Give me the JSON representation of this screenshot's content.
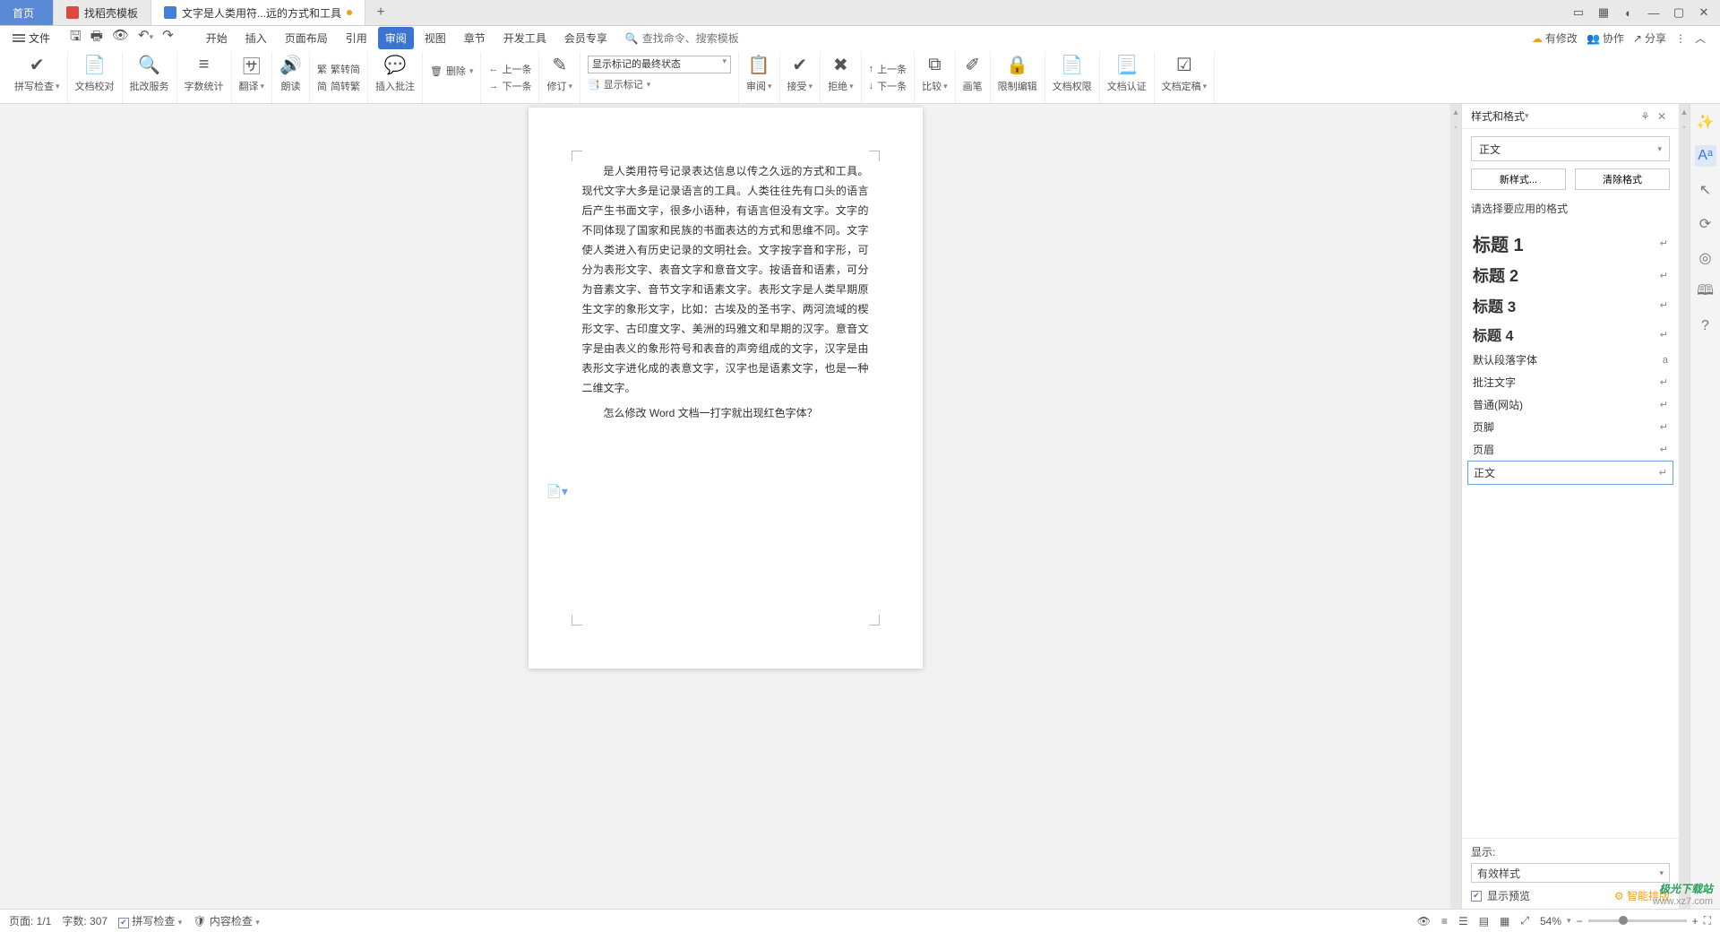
{
  "tabs": {
    "home": "首页",
    "template": "找稻壳模板",
    "doc": "文字是人类用符...远的方式和工具"
  },
  "menu": {
    "file": "文件",
    "items": [
      "开始",
      "插入",
      "页面布局",
      "引用",
      "审阅",
      "视图",
      "章节",
      "开发工具",
      "会员专享"
    ],
    "active": "审阅",
    "search_ph": "查找命令、搜索模板"
  },
  "topright": {
    "changes": "有修改",
    "coop": "协作",
    "share": "分享"
  },
  "ribbon": {
    "spell": "拼写检查",
    "proof": "文档校对",
    "approve": "批改服务",
    "wordcount": "字数统计",
    "translate": "翻译",
    "read": "朗读",
    "t2s": "繁转简",
    "s2t": "简转繁",
    "newcomment": "插入批注",
    "delete": "删除",
    "prev": "上一条",
    "next": "下一条",
    "revise": "修订",
    "markup_state": "显示标记的最终状态",
    "show_markup": "显示标记",
    "reviewpane": "审阅",
    "accept": "接受",
    "reject": "拒绝",
    "prev2": "上一条",
    "next2": "下一条",
    "compare": "比较",
    "pen": "画笔",
    "restrict": "限制编辑",
    "docperm": "文档权限",
    "doccert": "文档认证",
    "docfinal": "文档定稿"
  },
  "doc": {
    "p1": "是人类用符号记录表达信息以传之久远的方式和工具。现代文字大多是记录语言的工具。人类往往先有口头的语言后产生书面文字，很多小语种，有语言但没有文字。文字的不同体现了国家和民族的书面表达的方式和思维不同。文字使人类进入有历史记录的文明社会。文字按字音和字形，可分为表形文字、表音文字和意音文字。按语音和语素，可分为音素文字、音节文字和语素文字。表形文字是人类早期原生文字的象形文字，比如：古埃及的圣书字、两河流域的楔形文字、古印度文字、美洲的玛雅文和早期的汉字。意音文字是由表义的象形符号和表音的声旁组成的文字，汉字是由表形文字进化成的表意文字，汉字也是语素文字，也是一种二维文字。",
    "p2": "怎么修改 Word 文档一打字就出现红色字体？"
  },
  "panel": {
    "title": "样式和格式",
    "current": "正文",
    "new": "新样式...",
    "clear": "清除格式",
    "prompt": "请选择要应用的格式",
    "styles": [
      {
        "n": "标题 1",
        "c": "h1"
      },
      {
        "n": "标题 2",
        "c": "h2"
      },
      {
        "n": "标题 3",
        "c": "h3"
      },
      {
        "n": "标题 4",
        "c": "h4"
      },
      {
        "n": "默认段落字体",
        "c": "small",
        "r": "a"
      },
      {
        "n": "批注文字",
        "c": "small"
      },
      {
        "n": "普通(网站)",
        "c": "small"
      },
      {
        "n": "页脚",
        "c": "small"
      },
      {
        "n": "页眉",
        "c": "small"
      },
      {
        "n": "正文",
        "c": "small",
        "sel": true
      }
    ],
    "show": "显示",
    "show_val": "有效样式",
    "preview": "显示预览",
    "ai": "智能排版"
  },
  "status": {
    "page": "页面: 1/1",
    "words": "字数: 307",
    "spell": "拼写检查",
    "content": "内容检查",
    "zoom": "54%"
  },
  "watermark": {
    "l1": "极光下载站",
    "l2": "www.xz7.com"
  }
}
